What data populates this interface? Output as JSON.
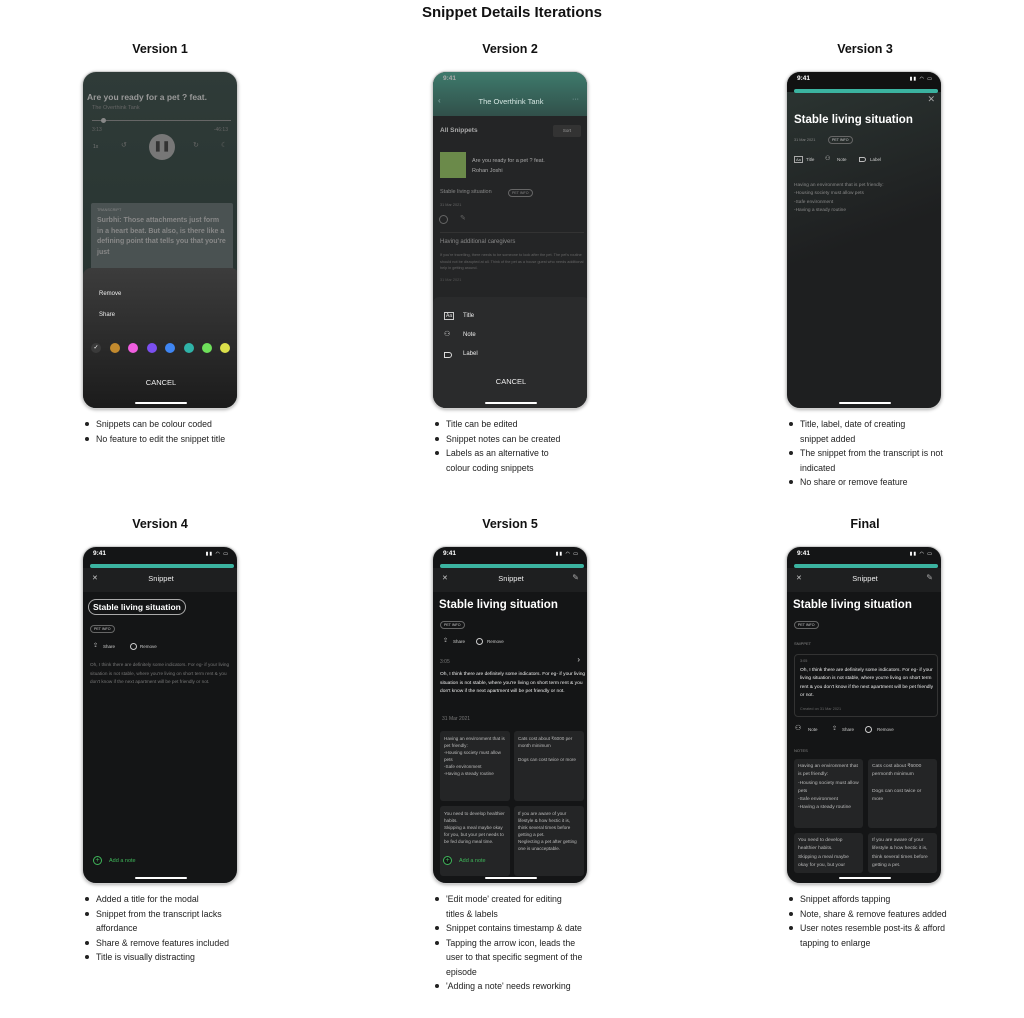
{
  "page_title": "Snippet Details Iterations",
  "status_time": "9:41",
  "v1": {
    "heading": "Version 1",
    "episode_title": "Are you ready for a pet ? feat.",
    "podcast": "The Overthink Tank",
    "elapsed": "3:13",
    "remaining": "-46:13",
    "speed": "1x",
    "transcript_label": "TRANSCRIPT",
    "transcript": "Surbhi: Those attachments just form in a heart beat. But also, is there like a defining point that tells you that you're just",
    "menu": [
      "Remove",
      "Share"
    ],
    "colors": [
      "#3a3a3a",
      "#c28a2e",
      "#f05ee0",
      "#7b4ff0",
      "#3f86f3",
      "#2fb3a8",
      "#6ee05a",
      "#dbe04a"
    ],
    "cancel": "CANCEL",
    "bullets": [
      "Snippets can be colour coded",
      "No feature to edit the snippet title"
    ]
  },
  "v2": {
    "heading": "Version 2",
    "nav_title": "The Overthink Tank",
    "section": "All Snippets",
    "sort": "Sort",
    "episode": "Are you ready for a pet ? feat. Rohan Joshi",
    "snippet1": "Stable living situation",
    "label": "PET INFO",
    "date": "31 Mar 2021",
    "snippet2": "Having additional caregivers",
    "snippet2_text": "If you're travelling, there needs to be someone to look after the pet. The pet's routine should not be disrupted at all. Think of the pet as a house guest who needs additional help in getting around.",
    "menu": [
      "Title",
      "Note",
      "Label"
    ],
    "cancel": "CANCEL",
    "bullets": [
      "Title can be edited",
      "Snippet notes can be created",
      "Labels as an alternative to colour coding snippets"
    ]
  },
  "v3": {
    "heading": "Version 3",
    "title": "Stable living situation",
    "date": "31 Mar 2021",
    "label": "PET INFO",
    "actions": [
      "Title",
      "Note",
      "Label"
    ],
    "note": "Having an environment that is pet friendly:\n   -Housing society must allow pets\n   -Safe environment\n   -Having a steady routine",
    "bullets": [
      "Title, label, date of creating snippet added",
      "The snippet from the transcript is not indicated",
      "No share or remove feature"
    ]
  },
  "v4": {
    "heading": "Version 4",
    "header": "Snippet",
    "title": "Stable living situation",
    "label": "PET INFO",
    "share": "Share",
    "remove": "Remove",
    "text": "Oh, I think there are definitely some indicators. For eg- if your living situation is not stable, where you're living on short term rent & you don't know if the next apartment will be pet friendly or not.",
    "add_note": "Add a note",
    "bullets": [
      "Added a title for the modal",
      "Snippet from the transcript lacks affordance",
      "Share & remove features included",
      "Title is visually distracting"
    ]
  },
  "v5": {
    "heading": "Version 5",
    "header": "Snippet",
    "title": "Stable living situation",
    "label": "PET INFO",
    "share": "Share",
    "remove": "Remove",
    "timestamp": "3:05",
    "text": "Oh, I think there are definitely some indicators. For eg- if your living situation is not stable, where you're living on short term rent & you don't know if the next apartment will be pet friendly or not.",
    "date": "31 Mar 2021",
    "notes": [
      "Having an environment that is pet friendly:\n-Housing society must allow pets\n-Safe environment\n-Having a steady routine",
      "Cats cost about ₹6000 per month minimum\n\nDogs can cost twice or more",
      "You need to develop healthier habits.\nSkipping a meal maybe okay for you, but your pet needs to be fed during meal time.",
      "If you are aware of your lifestyle & how hectic it is, think several times before getting a pet.\nNeglecting a pet after getting one is unacceptable."
    ],
    "add_note": "Add a note",
    "bullets": [
      "'Edit mode' created for editing titles & labels",
      "Snippet contains timestamp & date",
      "Tapping the arrow icon, leads the user to that specific segment of the episode",
      "'Adding a note' needs reworking"
    ]
  },
  "final": {
    "heading": "Final",
    "header": "Snippet",
    "title": "Stable living situation",
    "label": "PET INFO",
    "snippet_label": "SNIPPET",
    "timestamp": "3:05",
    "text": "Oh, I think there are definitely some indicators. For eg- if your living situation is not stable, where you're living on short term rent & you don't know if the next apartment will be pet friendly or not.",
    "created": "Created on 31 Mar 2021",
    "note": "Note",
    "share": "Share",
    "remove": "Remove",
    "notes_label": "NOTES",
    "notes": [
      "Having an environment that is pet friendly:\n-Housing society must allow pets\n-Safe environment\n-Having a steady routine",
      "Cats cost about ₹6000 permonth minimum\n\nDogs can cost twice or more",
      "You need to develop healthier habits.\nSkipping a meal maybe okay for you, but your",
      "If you are aware of your lifestyle & how hectic it is, think several times before getting a pet."
    ],
    "bullets": [
      "Snippet affords tapping",
      "Note, share & remove features added",
      "User notes resemble post-its & afford tapping to enlarge"
    ]
  }
}
